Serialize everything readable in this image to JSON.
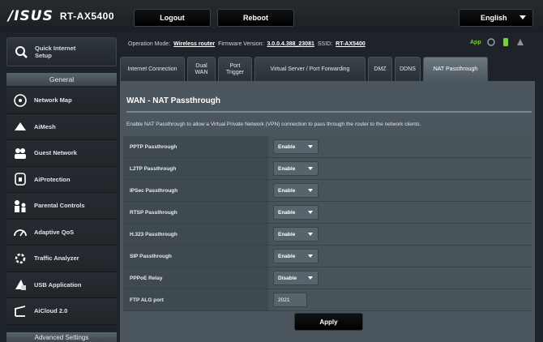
{
  "header": {
    "brand": "/ISUS",
    "model": "RT-AX5400",
    "logout_label": "Logout",
    "reboot_label": "Reboot",
    "language": "English"
  },
  "status": {
    "op_mode_label": "Operation Mode:",
    "op_mode_value": "Wireless router",
    "firmware_label": "Firmware Version:",
    "firmware_value": "3.0.0.4.388_23081",
    "ssid_label": "SSID:",
    "ssid_value": "RT-AX5400",
    "app_label": "App"
  },
  "sidebar": {
    "quick_setup": "Quick Internet Setup",
    "general_header": "General",
    "items": [
      {
        "label": "Network Map",
        "icon": "network-map-icon"
      },
      {
        "label": "AiMesh",
        "icon": "aimesh-icon"
      },
      {
        "label": "Guest Network",
        "icon": "guest-network-icon"
      },
      {
        "label": "AiProtection",
        "icon": "aiprotection-icon"
      },
      {
        "label": "Parental Controls",
        "icon": "parental-controls-icon"
      },
      {
        "label": "Adaptive QoS",
        "icon": "adaptive-qos-icon"
      },
      {
        "label": "Traffic Analyzer",
        "icon": "traffic-analyzer-icon"
      },
      {
        "label": "USB Application",
        "icon": "usb-application-icon"
      },
      {
        "label": "AiCloud 2.0",
        "icon": "aicloud-icon"
      }
    ],
    "advanced_header": "Advanced Settings"
  },
  "tabs": [
    {
      "label": "Internet Connection",
      "active": false
    },
    {
      "label": "Dual WAN",
      "active": false
    },
    {
      "label": "Port Trigger",
      "active": false
    },
    {
      "label": "Virtual Server / Port Forwarding",
      "active": false
    },
    {
      "label": "DMZ",
      "active": false
    },
    {
      "label": "DDNS",
      "active": false
    },
    {
      "label": "NAT Passthrough",
      "active": true
    }
  ],
  "page": {
    "title": "WAN - NAT Passthrough",
    "description": "Enable NAT Passthrough to allow a Virtual Private Network (VPN) connection to pass through the router to the network clients.",
    "rows": [
      {
        "label": "PPTP Passthrough",
        "value": "Enable"
      },
      {
        "label": "L2TP Passthrough",
        "value": "Enable"
      },
      {
        "label": "IPSec Passthrough",
        "value": "Enable"
      },
      {
        "label": "RTSP Passthrough",
        "value": "Enable"
      },
      {
        "label": "H.323 Passthrough",
        "value": "Enable"
      },
      {
        "label": "SIP Passthrough",
        "value": "Enable"
      },
      {
        "label": "PPPoE Relay",
        "value": "Disable"
      },
      {
        "label": "FTP ALG port",
        "value": "2021"
      }
    ],
    "apply_label": "Apply"
  },
  "colors": {
    "background": "#1d2328",
    "panel": "#4c565e",
    "accent_green": "#76d23c"
  }
}
